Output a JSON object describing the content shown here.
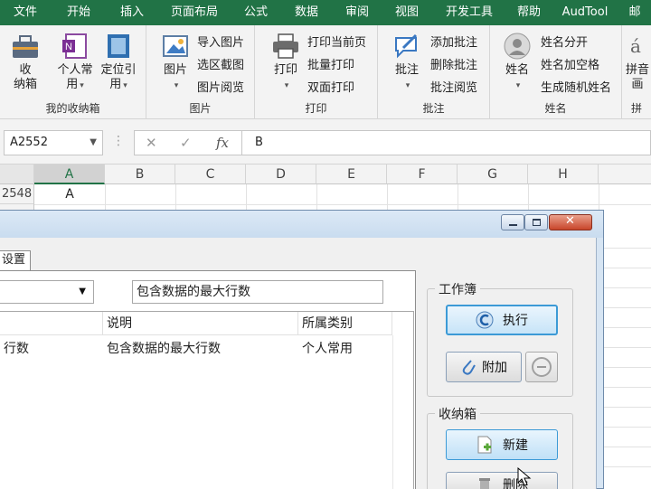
{
  "menu": [
    "文件",
    "开始",
    "插入",
    "页面布局",
    "公式",
    "数据",
    "审阅",
    "视图",
    "开发工具",
    "帮助",
    "AudTool",
    "邮"
  ],
  "ribbon": {
    "group1": {
      "label": "我的收纳箱",
      "btn1": "收\n纳箱",
      "btn2_l1": "个人常",
      "btn2_l2": "用",
      "btn3_l1": "定位引",
      "btn3_l2": "用"
    },
    "group2": {
      "label": "图片",
      "big": "图片",
      "items": [
        "导入图片",
        "选区截图",
        "图片阅览"
      ]
    },
    "group3": {
      "label": "打印",
      "big": "打印",
      "items": [
        "打印当前页",
        "批量打印",
        "双面打印"
      ]
    },
    "group4": {
      "label": "批注",
      "big": "批注",
      "items": [
        "添加批注",
        "删除批注",
        "批注阅览"
      ]
    },
    "group5": {
      "label": "姓名",
      "big": "姓名",
      "items": [
        "姓名分开",
        "姓名加空格",
        "生成随机姓名"
      ]
    },
    "group6": {
      "label": "拼",
      "big_l1": "拼音",
      "big_l2": "画"
    }
  },
  "formula_bar": {
    "name_box": "A2552",
    "fx": "fx",
    "value": "B"
  },
  "sheet": {
    "columns": [
      "A",
      "B",
      "C",
      "D",
      "E",
      "F",
      "G",
      "H"
    ],
    "rows": [
      {
        "num": "2548",
        "a": "A"
      }
    ]
  },
  "dialog": {
    "tab": "设置",
    "description": "包含数据的最大行数",
    "list": {
      "headers": [
        "说明",
        "所属类别"
      ],
      "rows": [
        {
          "name": "行数",
          "desc": "包含数据的最大行数",
          "cat": "个人常用"
        }
      ]
    },
    "workbook_group": "工作簿",
    "execute": "执行",
    "attach": "附加",
    "box_group": "收纳箱",
    "new": "新建",
    "delete": "删除"
  }
}
